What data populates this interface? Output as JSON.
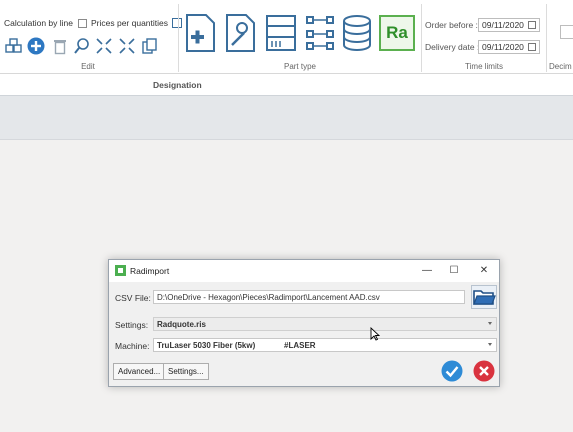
{
  "ribbon": {
    "edit": {
      "calc_by_line": "Calculation by line",
      "prices_per_quantities": "Prices per quantities",
      "group_label": "Edit",
      "icons": [
        "cubes-icon",
        "add-icon",
        "trash-icon",
        "find-icon",
        "collapse-icon",
        "expand-icon",
        "copy-docs-icon"
      ]
    },
    "part_type": {
      "group_label": "Part type",
      "icons": [
        "sheet-part-icon",
        "tube-part-icon",
        "cabinet-icon",
        "component-icon",
        "database-icon"
      ],
      "ra_label": "Ra"
    },
    "time_limits": {
      "group_label": "Time limits",
      "order_before_label": "Order before :",
      "order_before_value": "09/11/2020",
      "delivery_date_label": "Delivery date :",
      "delivery_date_value": "09/11/2020"
    },
    "decimals": {
      "group_label": "Decim"
    }
  },
  "designation": {
    "label": "Designation"
  },
  "dialog": {
    "title": "Radimport",
    "csv_label": "CSV File:",
    "csv_value": "D:\\OneDrive - Hexagon\\Pieces\\Radimport\\Lancement AAD.csv",
    "settings_label": "Settings:",
    "settings_value": "Radquote.ris",
    "machine_label": "Machine:",
    "machine_value": "TruLaser 5030 Fiber (5kw)",
    "machine_tag": "#LASER",
    "advanced_button": "Advanced...",
    "settings_button": "Settings...",
    "window_controls": {
      "minimize": "—",
      "maximize": "☐",
      "close": "✕"
    }
  },
  "colors": {
    "accent_green": "#4caf50",
    "ok_blue": "#2e8bd6",
    "cancel_red": "#d9333f",
    "icon_blue": "#3a6e9c"
  }
}
